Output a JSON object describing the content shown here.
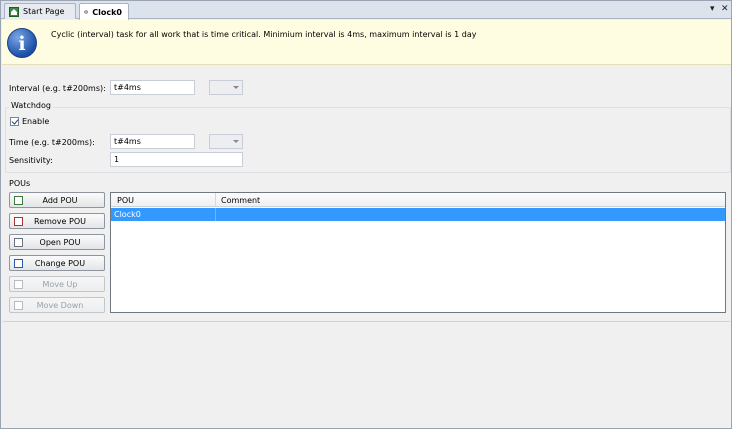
{
  "tabs": [
    {
      "label": "Start Page",
      "icon": "home-icon"
    },
    {
      "label": "Clock0",
      "icon": "task-icon"
    }
  ],
  "tabbar_controls": {
    "dropdown_glyph": "▾",
    "close_glyph": "✕"
  },
  "info": {
    "text": "Cyclic (interval) task for all work that is time critical. Minimium interval is 4ms, maximum interval is 1 day",
    "icon": "info-icon",
    "icon_glyph": "i"
  },
  "interval": {
    "label": "Interval (e.g. t#200ms):",
    "value": "t#4ms"
  },
  "watchdog": {
    "title": "Watchdog",
    "enable_label": "Enable",
    "enabled": true,
    "time_label": "Time (e.g. t#200ms):",
    "time_value": "t#4ms",
    "sensitivity_label": "Sensitivity:",
    "sensitivity_value": "1"
  },
  "pous": {
    "title": "POUs",
    "buttons": [
      {
        "label": "Add POU",
        "enabled": true
      },
      {
        "label": "Remove POU",
        "enabled": true
      },
      {
        "label": "Open POU",
        "enabled": true
      },
      {
        "label": "Change POU",
        "enabled": true
      },
      {
        "label": "Move Up",
        "enabled": false
      },
      {
        "label": "Move Down",
        "enabled": false
      }
    ],
    "columns": [
      "POU",
      "Comment"
    ],
    "rows": [
      {
        "pou": "Clock0",
        "comment": "",
        "selected": true
      }
    ]
  },
  "colors": {
    "selection": "#3399ff",
    "info_background": "#fffde1"
  }
}
